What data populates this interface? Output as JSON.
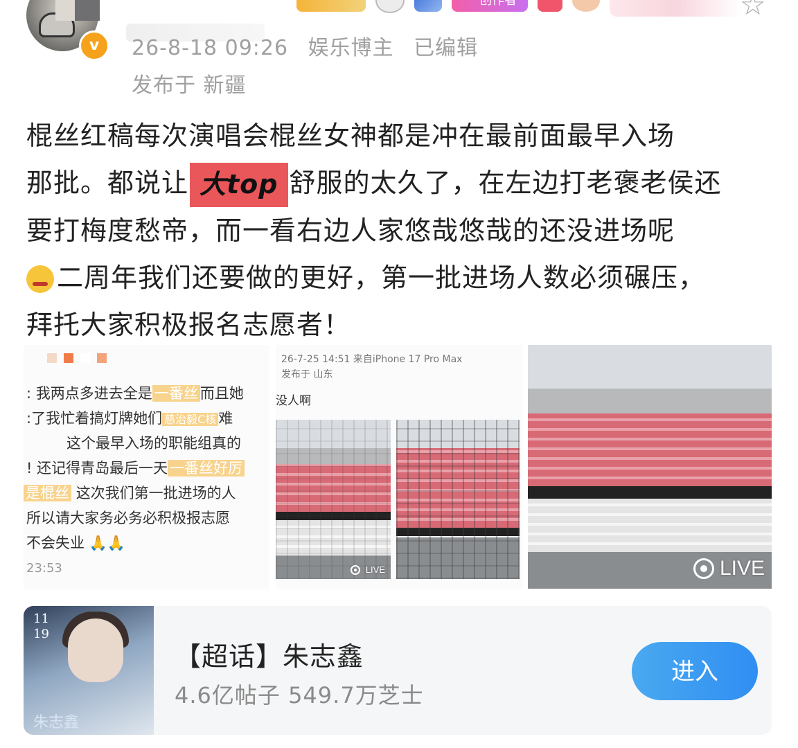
{
  "header": {
    "time": "26-8-18 09:26",
    "category": "娱乐博主",
    "edited": "已编辑",
    "location": "发布于 新疆",
    "badge_pink_label": "创作者",
    "icons": [
      "avatar",
      "verified-badge",
      "star-icon"
    ]
  },
  "post": {
    "line1": "棍丝红稿每次演唱会棍丝女神都是冲在最前面最早入场",
    "line2_a": "那批。都说让",
    "highlight": "大top",
    "line2_b": "舒服的太久了，在左边打老褒老侯还",
    "line3": "要打梅度愁帝，而一看右边人家悠哉悠哉的还没进场呢",
    "line4": "二周年我们还要做的更好，第一批进场人数必须碾压，",
    "line5": "拜托大家积极报名志愿者！"
  },
  "image1": {
    "lines": [
      ": 我两点多进去全是",
      "一番丝",
      "而且她",
      ":了我忙着搞灯牌她们",
      "慈治毅C核",
      "难",
      "这个最早入场的职能组真的",
      "! 还记得青岛最后一天",
      "一番丝好厉",
      "是棍丝",
      "这次我们第一批进场的人",
      "所以请大家务必务必积极报志愿",
      "不会失业 🙏🙏"
    ],
    "time": "23:53"
  },
  "image2": {
    "meta": "26-7-25 14:51 来自iPhone 17 Pro Max",
    "location": "发布于 山东",
    "text": "没人啊",
    "live": "LIVE"
  },
  "image3": {
    "live": "LIVE"
  },
  "card": {
    "title": "【超话】朱志鑫",
    "stats": "4.6亿帖子 549.7万芝士",
    "button": "进入",
    "cover_date": "11\n19",
    "cover_text": "朱志鑫"
  },
  "colors": {
    "highlight_bg": "#e9575b",
    "button_bg": "#2f8ef2",
    "meta_gray": "#a0a0a0"
  }
}
